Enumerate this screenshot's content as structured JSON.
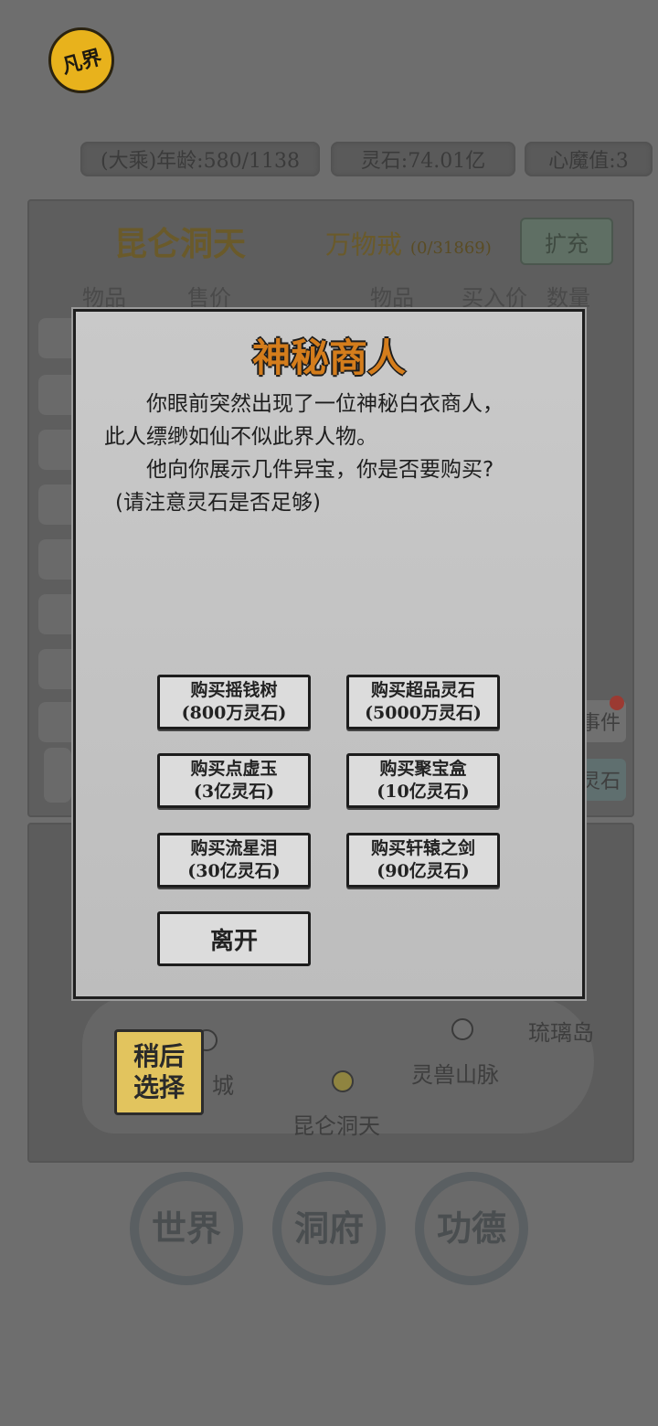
{
  "header": {
    "logo_text": "凡界",
    "age_label": "(大乘)年龄:580/1138",
    "spirit_stone_label": "灵石:74.01亿",
    "heart_demon_label": "心魔值:3"
  },
  "back_panel": {
    "location_title": "昆仑洞天",
    "ring_title": "万物戒",
    "ring_capacity": "(0/31869)",
    "expand_label": "扩充",
    "left_headers": [
      "物品",
      "售价"
    ],
    "right_headers": [
      "物品",
      "买入价",
      "数量"
    ],
    "right_stubs": [
      "事件",
      "灵石"
    ]
  },
  "map": {
    "labels": {
      "liuli_island": "琉璃岛",
      "lingshou_mountains": "灵兽山脉",
      "kunlun": "昆仑洞天",
      "city": "城"
    },
    "later_label": "稍后选择"
  },
  "bottom_nav": [
    {
      "label": "世界"
    },
    {
      "label": "洞府"
    },
    {
      "label": "功德"
    }
  ],
  "modal": {
    "title": "神秘商人",
    "line1": "你眼前突然出现了一位神秘白衣商人，",
    "line2": "此人缥缈如仙不似此界人物。",
    "line3": "他向你展示几件异宝，你是否要购买?",
    "line4": "(请注意灵石是否足够)",
    "options": [
      {
        "name": "购买摇钱树",
        "price": "(800万灵石)"
      },
      {
        "name": "购买超品灵石",
        "price": "(5000万灵石)"
      },
      {
        "name": "购买点虚玉",
        "price": "(3亿灵石)"
      },
      {
        "name": "购买聚宝盒",
        "price": "(10亿灵石)"
      },
      {
        "name": "购买流星泪",
        "price": "(30亿灵石)"
      },
      {
        "name": "购买轩辕之剑",
        "price": "(90亿灵石)"
      }
    ],
    "leave_label": "离开"
  }
}
